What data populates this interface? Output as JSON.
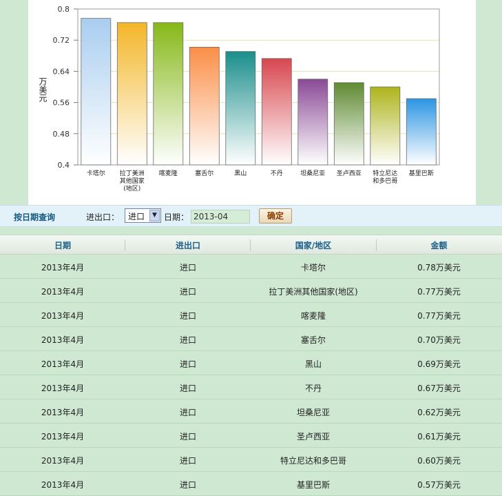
{
  "chart_data": {
    "type": "bar",
    "ylabel": "万美元",
    "ylim": [
      0.4,
      0.8
    ],
    "yticks": [
      "0.8",
      "0.72",
      "0.64",
      "0.56",
      "0.48",
      "0.4"
    ],
    "categories": [
      [
        "卡塔尔"
      ],
      [
        "拉丁美洲",
        "其他国家",
        "(地区)"
      ],
      [
        "喀麦隆"
      ],
      [
        "塞舌尔"
      ],
      [
        "黑山"
      ],
      [
        "不丹"
      ],
      [
        "坦桑尼亚"
      ],
      [
        "圣卢西亚"
      ],
      [
        "特立尼达",
        "和多巴哥"
      ],
      [
        "基里巴斯"
      ]
    ],
    "values": [
      0.776,
      0.765,
      0.765,
      0.702,
      0.691,
      0.673,
      0.62,
      0.611,
      0.6,
      0.57
    ],
    "colors": [
      "#a9cdf0",
      "#f3b628",
      "#86b818",
      "#fb8e46",
      "#1a8e8b",
      "#d8474f",
      "#8a4a96",
      "#5f8a32",
      "#aeb41c",
      "#2c95e3"
    ],
    "grid": true
  },
  "query": {
    "title": "按日期查询",
    "type_label": "进出口：",
    "type_value": "进口",
    "date_label": "日期：",
    "date_value": "2013-04",
    "confirm_label": "确定"
  },
  "table": {
    "headers": [
      "日期",
      "进出口",
      "国家/地区",
      "金额"
    ],
    "rows": [
      [
        "2013年4月",
        "进口",
        "卡塔尔",
        "0.78万美元"
      ],
      [
        "2013年4月",
        "进口",
        "拉丁美洲其他国家(地区)",
        "0.77万美元"
      ],
      [
        "2013年4月",
        "进口",
        "喀麦隆",
        "0.77万美元"
      ],
      [
        "2013年4月",
        "进口",
        "塞舌尔",
        "0.70万美元"
      ],
      [
        "2013年4月",
        "进口",
        "黑山",
        "0.69万美元"
      ],
      [
        "2013年4月",
        "进口",
        "不丹",
        "0.67万美元"
      ],
      [
        "2013年4月",
        "进口",
        "坦桑尼亚",
        "0.62万美元"
      ],
      [
        "2013年4月",
        "进口",
        "圣卢西亚",
        "0.61万美元"
      ],
      [
        "2013年4月",
        "进口",
        "特立尼达和多巴哥",
        "0.60万美元"
      ],
      [
        "2013年4月",
        "进口",
        "基里巴斯",
        "0.57万美元"
      ]
    ]
  }
}
